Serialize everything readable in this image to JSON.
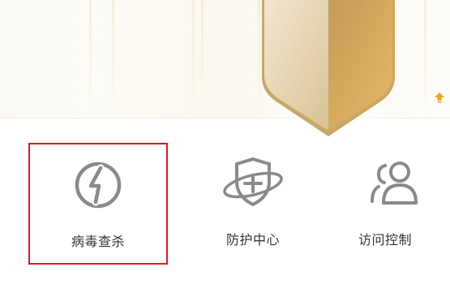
{
  "hero": {
    "shield_icon": "gold-shield-icon",
    "scroll_icon": "up-arrow-icon"
  },
  "features": [
    {
      "label": "病毒查杀",
      "icon": "virus-scan-icon",
      "selected": true
    },
    {
      "label": "防护中心",
      "icon": "protection-center-icon",
      "selected": false
    },
    {
      "label": "访问控制",
      "icon": "access-control-icon",
      "selected": false
    }
  ],
  "colors": {
    "gold": "#c9a15e",
    "icon_gray": "#8a8a8a",
    "highlight_red": "#e0191e",
    "label_text": "#333333",
    "arrow_orange": "#f2a516"
  }
}
